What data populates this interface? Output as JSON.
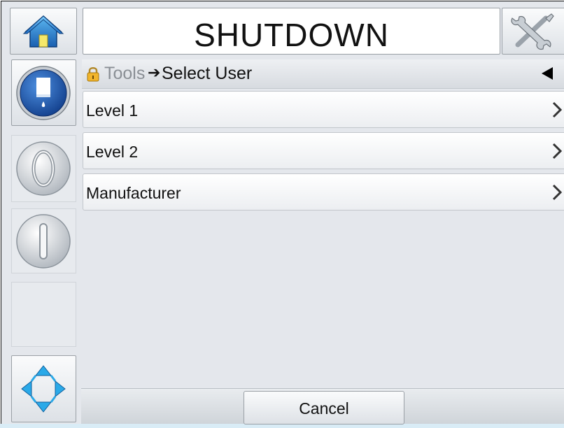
{
  "header": {
    "title": "SHUTDOWN"
  },
  "breadcrumb": {
    "parent": "Tools",
    "separator": "➔",
    "current": "Select User"
  },
  "list": {
    "items": [
      {
        "label": "Level 1"
      },
      {
        "label": "Level 2"
      },
      {
        "label": "Manufacturer"
      }
    ]
  },
  "footer": {
    "cancel_label": "Cancel"
  },
  "icons": {
    "home": "home-icon",
    "tools": "tools-icon",
    "ink": "ink-cartridge-icon",
    "start": "start-icon",
    "stop": "stop-icon",
    "navigation": "navigation-arrows-icon",
    "lock": "lock-icon",
    "back": "back-icon",
    "chevron": "chevron-right-icon"
  },
  "colors": {
    "accent_blue": "#2b6cc4",
    "background": "#e4e7ec"
  }
}
